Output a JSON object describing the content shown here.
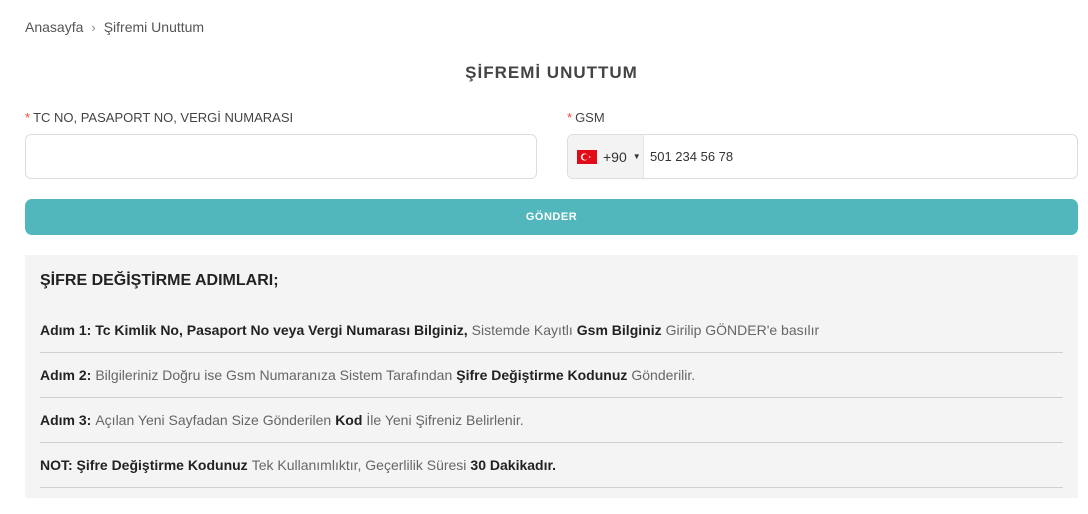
{
  "breadcrumb": {
    "home": "Anasayfa",
    "separator": "›",
    "current": "Şifremi Unuttum"
  },
  "page": {
    "title": "ŞİFREMİ UNUTTUM"
  },
  "form": {
    "tc_label": "TC NO, PASAPORT NO, VERGİ NUMARASI",
    "required_mark": "*",
    "tc_value": "",
    "gsm_label": "GSM",
    "country_dial_code": "+90",
    "country_flag": "turkey-flag-icon",
    "phone_placeholder": "501 234 56 78",
    "submit_label": "GÖNDER"
  },
  "steps": {
    "title": "ŞİFRE DEĞİŞTİRME ADIMLARI;",
    "items": [
      {
        "bold1": "Adım 1: Tc Kimlik No, Pasaport No veya Vergi Numarası Bilginiz,",
        "text1": "Sistemde Kayıtlı",
        "bold2": "Gsm Bilginiz",
        "text2": "Girilip GÖNDER'e basılır"
      },
      {
        "bold1": "Adım 2:",
        "text1": "Bilgileriniz Doğru ise Gsm Numaranıza Sistem Tarafından",
        "bold2": "Şifre Değiştirme Kodunuz",
        "text2": "Gönderilir."
      },
      {
        "bold1": "Adım 3:",
        "text1": "Açılan Yeni Sayfadan Size Gönderilen",
        "bold2": "Kod",
        "text2": "İle Yeni Şifreniz Belirlenir."
      },
      {
        "bold1": "NOT: Şifre Değiştirme Kodunuz",
        "text1": "Tek Kullanımlıktır, Geçerlilik Süresi",
        "bold2": "30 Dakikadır.",
        "text2": ""
      }
    ]
  },
  "colors": {
    "accent": "#52b7bc",
    "required": "#e74c3c",
    "panel_bg": "#f4f4f5"
  }
}
